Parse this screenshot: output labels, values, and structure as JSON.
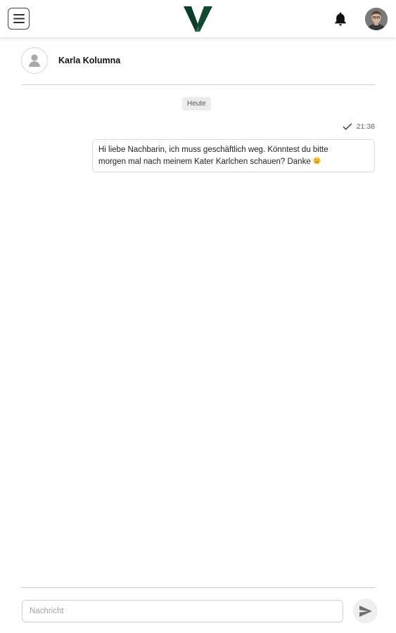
{
  "header": {
    "menu_icon": "hamburger-menu-icon",
    "logo_icon": "v-logo-icon",
    "notification_icon": "bell-icon",
    "colors": {
      "logo_dark": "#0f3d2b",
      "logo_light": "#2e6b4b"
    }
  },
  "conversation": {
    "contact_name": "Karla Kolumna",
    "contact_avatar_icon": "person-placeholder-icon"
  },
  "messages": {
    "date_label": "Heute",
    "items": [
      {
        "time": "21:38",
        "status_icon": "check-icon",
        "line_1": "Hi liebe Nachbarin, ich muss geschäftlich weg. Könntest du bitte",
        "line_2": "morgen mal nach meinem Kater Karlchen schauen? Danke",
        "emoji_icon": "smiling-face-emoji-icon"
      }
    ]
  },
  "composer": {
    "placeholder": "Nachricht",
    "value": "",
    "send_icon": "send-icon"
  }
}
